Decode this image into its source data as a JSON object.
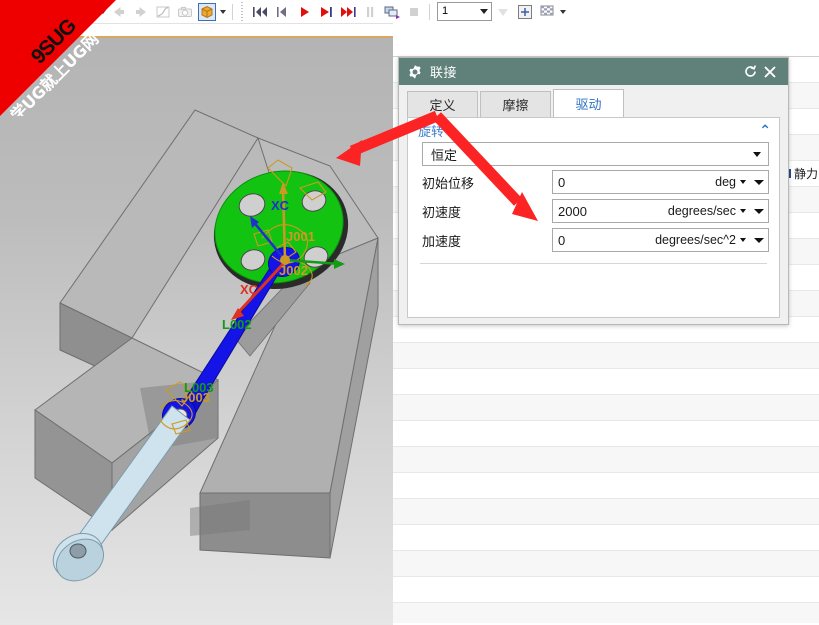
{
  "toolbar": {
    "icons": [
      {
        "name": "chart-curve-icon",
        "caret": true
      },
      {
        "name": "trace-icon",
        "caret": true
      },
      {
        "name": "spreadsheet-icon",
        "caret": true
      },
      {
        "name": "step-back-arrow-icon",
        "caret": false
      },
      {
        "name": "step-forward-arrow-icon",
        "caret": false
      },
      {
        "name": "graph-plot-icon",
        "caret": false
      },
      {
        "name": "camera-icon",
        "caret": false
      },
      {
        "name": "package-box-icon",
        "caret": true
      }
    ],
    "playback": [
      {
        "name": "rewind-to-start-button",
        "glyph": "|◀◀"
      },
      {
        "name": "step-backward-button",
        "glyph": "|◀"
      },
      {
        "name": "play-button",
        "glyph": "▶"
      },
      {
        "name": "play-to-end-button",
        "glyph": "▶|"
      },
      {
        "name": "fast-forward-button",
        "glyph": "▶▶|"
      },
      {
        "name": "pause-button",
        "glyph": "❙❙"
      },
      {
        "name": "export-animation-button",
        "glyph": "export"
      },
      {
        "name": "stop-button",
        "glyph": "■"
      }
    ],
    "step_value": "1",
    "after_combo": [
      {
        "name": "filter-down-button"
      },
      {
        "name": "add-step-button",
        "label": "+"
      },
      {
        "name": "finish-flag-button"
      }
    ]
  },
  "watermark": {
    "line1": "9SUG",
    "line2": "学UG就上UG网",
    "color": "#ef0000"
  },
  "viewport": {
    "labels": {
      "axis_xc_top": "XC",
      "axis_xc_bottom": "XC",
      "joint_j001": "J001",
      "joint_j002": "J002",
      "joint_j003": "J003",
      "link_l002": "L002",
      "link_l003": "L003"
    },
    "colors": {
      "disc": "#12c312",
      "link_blue": "#1414e6",
      "link_light": "#cfe3ee",
      "body_gray": "#b0b0b0",
      "marker_orange": "#cc9a22",
      "axis_red": "#e03020",
      "axis_green": "#139c13",
      "axis_blue": "#2030cc"
    }
  },
  "background_panel": {
    "row_label": "静力",
    "rows": 22
  },
  "dialog": {
    "title": "联接",
    "icon": "gear-icon",
    "reset_button": "↻",
    "close_button": "✕",
    "tabs": [
      {
        "label": "定义",
        "active": false
      },
      {
        "label": "摩擦",
        "active": false
      },
      {
        "label": "驱动",
        "active": true
      }
    ],
    "section": {
      "title": "旋转",
      "collapse_glyph": "⌃",
      "drive_type": "恒定",
      "fields": [
        {
          "label": "初始位移",
          "value": "0",
          "unit": "deg"
        },
        {
          "label": "初速度",
          "value": "2000",
          "unit": "degrees/sec"
        },
        {
          "label": "加速度",
          "value": "0",
          "unit": "degrees/sec^2"
        }
      ]
    }
  },
  "annotations": {
    "arrow_color": "#fb2323",
    "arrow_left_target": "green-disc-joint",
    "arrow_right_target": "initial-velocity-field"
  }
}
